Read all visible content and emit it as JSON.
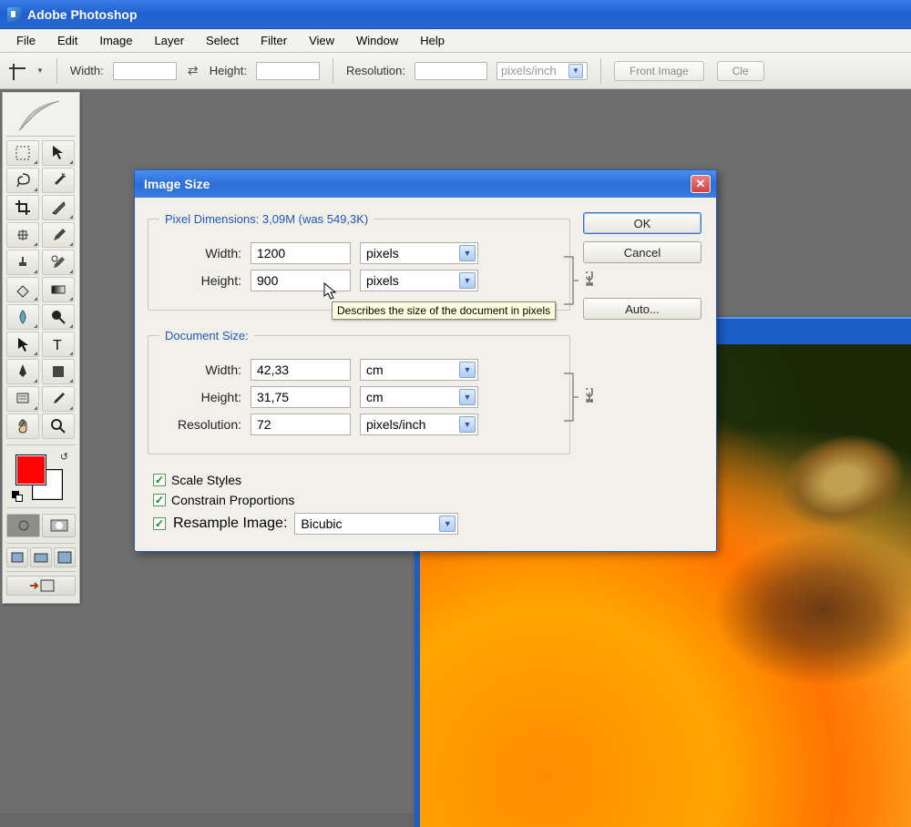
{
  "app": {
    "title": "Adobe Photoshop"
  },
  "menu": {
    "items": [
      "File",
      "Edit",
      "Image",
      "Layer",
      "Select",
      "Filter",
      "View",
      "Window",
      "Help"
    ]
  },
  "optionsbar": {
    "width_label": "Width:",
    "height_label": "Height:",
    "resolution_label": "Resolution:",
    "unit": "pixels/inch",
    "front_image": "Front Image",
    "clear": "Cle"
  },
  "dialog": {
    "title": "Image Size",
    "pixel_dims_label": "Pixel Dimensions:  3,09M (was 549,3K)",
    "doc_size_label": "Document Size:",
    "px": {
      "width_label": "Width:",
      "width_val": "1200",
      "width_unit": "pixels",
      "height_label": "Height:",
      "height_val": "900",
      "height_unit": "pixels"
    },
    "doc": {
      "width_label": "Width:",
      "width_val": "42,33",
      "width_unit": "cm",
      "height_label": "Height:",
      "height_val": "31,75",
      "height_unit": "cm",
      "res_label": "Resolution:",
      "res_val": "72",
      "res_unit": "pixels/inch"
    },
    "scale_styles": "Scale Styles",
    "constrain": "Constrain Proportions",
    "resample": "Resample Image:",
    "resample_method": "Bicubic",
    "ok": "OK",
    "cancel": "Cancel",
    "auto": "Auto...",
    "tooltip": "Describes the size of the document in pixels"
  }
}
